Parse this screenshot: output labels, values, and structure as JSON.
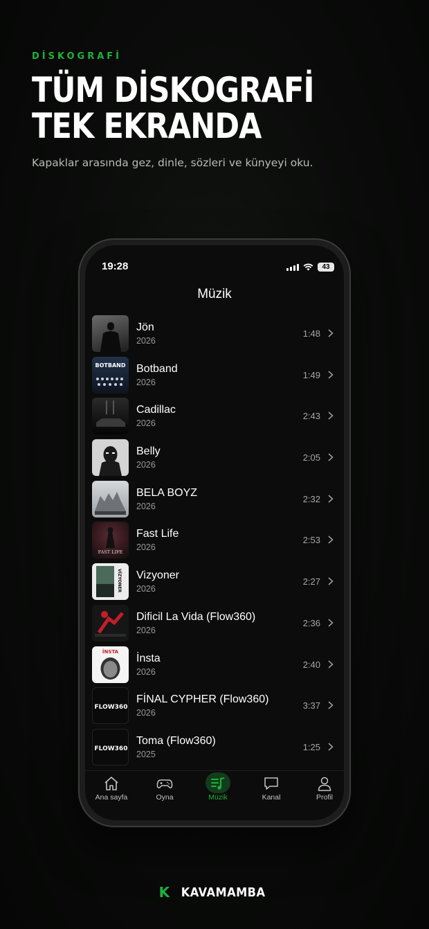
{
  "eyebrow": "DİSKOGRAFİ",
  "headline": {
    "line1": "TÜM DİSKOGRAFİ",
    "line2": "TEK EKRANDA"
  },
  "subtitle": "Kapaklar arasında gez, dinle, sözleri ve künyeyi oku.",
  "status": {
    "time": "19:28",
    "battery": "43"
  },
  "screen_title": "Müzik",
  "tracks": [
    {
      "title": "Jön",
      "year": "2026",
      "duration": "1:48",
      "cover": "#3a3a3a"
    },
    {
      "title": "Botband",
      "year": "2026",
      "duration": "1:49",
      "cover": "#1a2230"
    },
    {
      "title": "Cadillac",
      "year": "2026",
      "duration": "2:43",
      "cover": "#1a1a1a"
    },
    {
      "title": "Belly",
      "year": "2026",
      "duration": "2:05",
      "cover": "#cfcfcf"
    },
    {
      "title": "BELA BOYZ",
      "year": "2026",
      "duration": "2:32",
      "cover": "#b8bcbf"
    },
    {
      "title": "Fast Life",
      "year": "2026",
      "duration": "2:53",
      "cover": "#2a1e22"
    },
    {
      "title": "Vizyoner",
      "year": "2026",
      "duration": "2:27",
      "cover": "#e8e8e8"
    },
    {
      "title": "Dificil La Vida (Flow360)",
      "year": "2026",
      "duration": "2:36",
      "cover": "#181818"
    },
    {
      "title": "İnsta",
      "year": "2026",
      "duration": "2:40",
      "cover": "#f2f2f2"
    },
    {
      "title": "FİNAL CYPHER (Flow360)",
      "year": "2026",
      "duration": "3:37",
      "cover": "#0a0a0a"
    },
    {
      "title": "Toma (Flow360)",
      "year": "2025",
      "duration": "1:25",
      "cover": "#0a0a0a"
    }
  ],
  "cover_texts": {
    "botband": "BOTBAND",
    "fastlife": "FAST LIFE",
    "vizyoner": "VİZYONER",
    "insta": "İNSTA",
    "flow1": "FLOW360",
    "flow2": "FLOW360"
  },
  "tabs": [
    {
      "label": "Ana sayfa",
      "icon": "home-icon"
    },
    {
      "label": "Oyna",
      "icon": "gamepad-icon"
    },
    {
      "label": "Müzik",
      "icon": "music-list-icon"
    },
    {
      "label": "Kanal",
      "icon": "chat-bubble-icon"
    },
    {
      "label": "Profil",
      "icon": "person-icon"
    }
  ],
  "brand": {
    "mark": "K",
    "name": "KAVAMAMBA"
  },
  "colors": {
    "accent": "#1db33a",
    "background": "#0a0b0a",
    "screen": "#0c0c0c"
  }
}
